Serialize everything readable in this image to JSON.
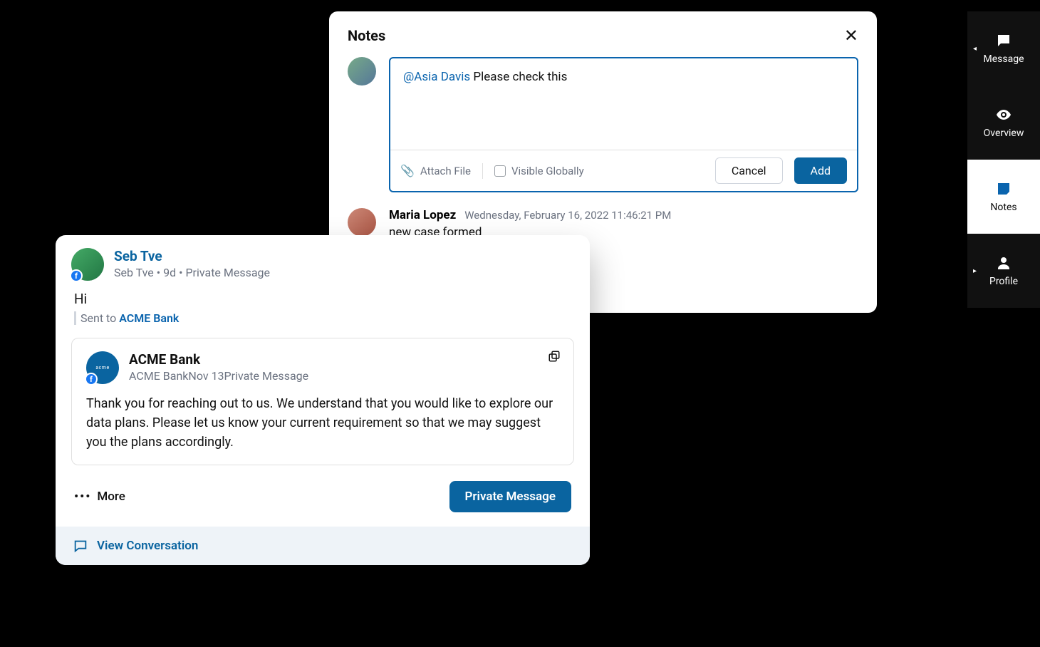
{
  "rail": {
    "message": "Message",
    "overview": "Overview",
    "notes": "Notes",
    "profile": "Profile"
  },
  "notes": {
    "title": "Notes",
    "compose": {
      "mention": "@Asia Davis",
      "text": " Please check this",
      "attach": "Attach File",
      "visible": "Visible Globally",
      "cancel": "Cancel",
      "add": "Add"
    },
    "history": [
      {
        "author": "Maria Lopez",
        "timestamp": "Wednesday, February 16, 2022 11:46:21 PM",
        "body": "new case formed"
      }
    ]
  },
  "conversation": {
    "sender": {
      "name": "Seb Tve",
      "meta_name": "Seb Tve",
      "age": "9d",
      "channel": "Private Message"
    },
    "body": "Hi",
    "sent_to_label": "Sent to ",
    "sent_to_target": "ACME Bank",
    "reply": {
      "company": "ACME Bank",
      "meta_name": "ACME Bank",
      "date": "Nov 13",
      "channel": "Private Message",
      "body": "Thank you for reaching out to us. We understand that you would like to explore our data plans. Please let us know your current requirement so that we may suggest you the plans accordingly.",
      "brand": "acme"
    },
    "more": "More",
    "pm_button": "Private Message",
    "view_conversation": "View Conversation"
  }
}
